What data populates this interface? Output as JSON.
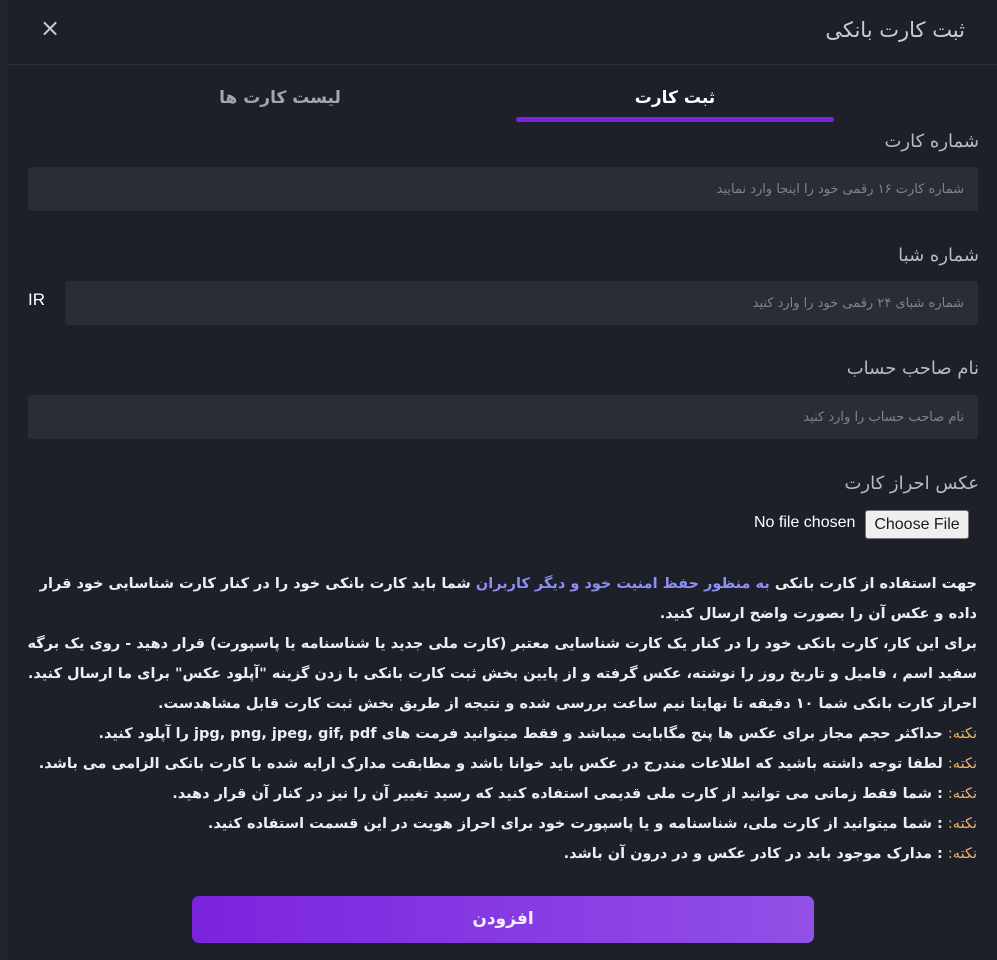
{
  "modal": {
    "title": "ثبت کارت بانکی",
    "close_icon": "×"
  },
  "tabs": [
    {
      "label": "ثبت کارت",
      "active": true
    },
    {
      "label": "لیست کارت ها",
      "active": false
    }
  ],
  "form": {
    "card_number": {
      "label": "شماره کارت",
      "placeholder": "شماره کارت ۱۶ رقمی خود را اینجا وارد نمایید",
      "value": ""
    },
    "sheba": {
      "label": "شماره شبا",
      "prefix": "IR",
      "placeholder": "شماره شبای ۲۴ رقمی خود را وارد کنید",
      "value": ""
    },
    "account_holder": {
      "label": "نام صاحب حساب",
      "placeholder": "نام صاحب حساب را وارد کنید",
      "value": ""
    },
    "card_photo": {
      "label": "عکس احراز کارت",
      "button_label": "Choose File",
      "status": "No file chosen"
    }
  },
  "instructions": {
    "para1_start": "جهت استفاده از کارت بانکی ",
    "para1_highlight": "به منظور حفظ امنیت خود و دیگر کاربران",
    "para1_end": " شما باید کارت بانکی خود را در کنار کارت شناسایی خود قرار داده و عکس آن را بصورت واضح ارسال کنید.",
    "para2": "برای این کار، کارت بانکی خود را در کنار یک کارت شناسایی معتبر (کارت ملی جدید یا شناسنامه یا پاسپورت) قرار دهید - روی یک برگه سفید اسم ، فامیل و تاریخ روز را نوشته، عکس گرفته و از پایین بخش ثبت کارت بانکی با زدن گزینه \"آپلود عکس\" برای ما ارسال کنید.",
    "para3": "احراز کارت بانکی شما ۱۰ دقیقه تا نهایتا نیم ساعت بررسی شده و نتیجه از طریق بخش ثبت کارت قابل مشاهدست.",
    "notes": [
      {
        "prefix": "نکته:",
        "text": " حداکثر حجم مجاز برای عکس ها پنج مگابایت میباشد و فقط میتوانید فرمت های jpg, png, jpeg, gif, pdf را آپلود کنید."
      },
      {
        "prefix": "نکته:",
        "text": " لطفا توجه داشته باشید که اطلاعات مندرج در عکس باید خوانا باشد و مطابقت مدارک ارایه شده با کارت بانکی الزامی می باشد."
      },
      {
        "prefix": "نکته:",
        "text": " : شما فقط زمانی می توانید از کارت ملی قدیمی استفاده کنید که رسید تغییر آن را نیز در کنار آن قرار دهید."
      },
      {
        "prefix": "نکته:",
        "text": " : شما میتوانید از کارت ملی، شناسنامه و یا پاسپورت خود برای احراز هویت در این قسمت استفاده کنید."
      },
      {
        "prefix": "نکته:",
        "text": " : مدارک موجود باید در کادر عکس و در درون آن باشد."
      }
    ]
  },
  "submit": {
    "label": "افزودن"
  },
  "colors": {
    "accent": "#7c22e4",
    "background": "#1d2029",
    "input_bg": "#2a2d36",
    "note": "#e9b368",
    "highlight": "#8d8ff6"
  }
}
